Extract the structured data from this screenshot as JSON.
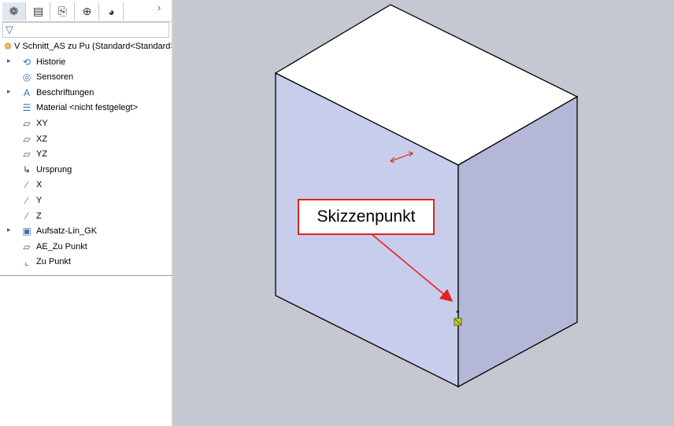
{
  "tabs": [
    {
      "name": "feature-manager",
      "icon": "feature-manager-icon",
      "glyph": "❁"
    },
    {
      "name": "property-manager",
      "icon": "property-manager-icon",
      "glyph": "▤"
    },
    {
      "name": "configuration-manager",
      "icon": "configuration-manager-icon",
      "glyph": "⎘"
    },
    {
      "name": "dimxpert-manager",
      "icon": "dimxpert-icon",
      "glyph": "⊕"
    },
    {
      "name": "display-manager",
      "icon": "display-manager-icon",
      "glyph": "◕"
    }
  ],
  "tab_more": "›",
  "filter_icon": "▽",
  "tree": {
    "root": "V Schnitt_AS zu Pu  (Standard<Standard>",
    "items": [
      {
        "label": "Historie",
        "icon": "history-folder-icon",
        "glyph": "⟲",
        "expandable": true
      },
      {
        "label": "Sensoren",
        "icon": "sensor-icon",
        "glyph": "◎",
        "expandable": false
      },
      {
        "label": "Beschriftungen",
        "icon": "annotations-icon",
        "glyph": "A",
        "expandable": true
      },
      {
        "label": "Material <nicht festgelegt>",
        "icon": "material-icon",
        "glyph": "☰",
        "expandable": false
      },
      {
        "label": "XY",
        "icon": "plane-icon",
        "glyph": "▱",
        "expandable": false
      },
      {
        "label": "XZ",
        "icon": "plane-icon",
        "glyph": "▱",
        "expandable": false
      },
      {
        "label": "YZ",
        "icon": "plane-icon",
        "glyph": "▱",
        "expandable": false
      },
      {
        "label": "Ursprung",
        "icon": "origin-icon",
        "glyph": "↳",
        "expandable": false
      },
      {
        "label": "X",
        "icon": "axis-icon",
        "glyph": "⁄",
        "expandable": false
      },
      {
        "label": "Y",
        "icon": "axis-icon",
        "glyph": "⁄",
        "expandable": false
      },
      {
        "label": "Z",
        "icon": "axis-icon",
        "glyph": "⁄",
        "expandable": false
      },
      {
        "label": "Aufsatz-Lin_GK",
        "icon": "extrude-icon",
        "glyph": "▣",
        "expandable": true
      },
      {
        "label": "AE_Zu Punkt",
        "icon": "plane-icon",
        "glyph": "▱",
        "expandable": false
      },
      {
        "label": "Zu Punkt",
        "icon": "sketch-icon",
        "glyph": "⌞",
        "expandable": false
      }
    ]
  },
  "callout": {
    "label": "Skizzenpunkt"
  },
  "colors": {
    "viewport_bg": "#c5c8d1",
    "box_top": "#ffffff",
    "box_front": "#c8cdeb",
    "box_side": "#b4b8d6",
    "annotation_red": "#e0241c",
    "point_green": "#d4c020"
  }
}
